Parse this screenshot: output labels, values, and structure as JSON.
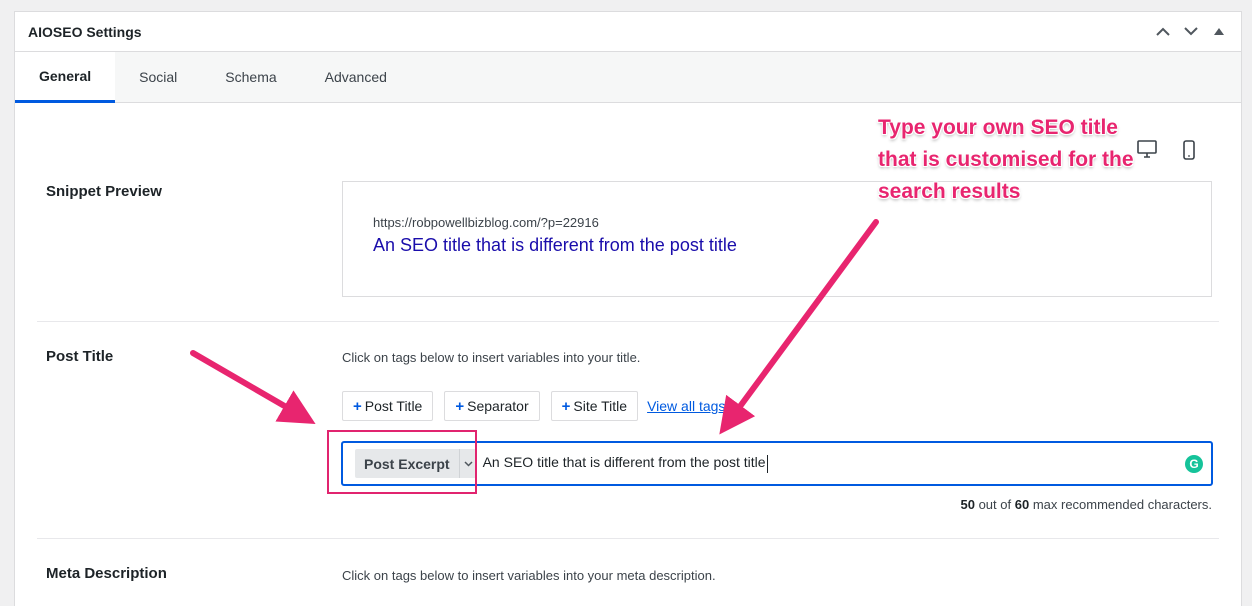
{
  "panel": {
    "title": "AIOSEO Settings"
  },
  "tabs": [
    "General",
    "Social",
    "Schema",
    "Advanced"
  ],
  "snippet_preview": {
    "label": "Snippet Preview",
    "url": "https://robpowellbizblog.com/?p=22916",
    "title": "An SEO title that is different from the post title"
  },
  "post_title": {
    "label": "Post Title",
    "hint": "Click on tags below to insert variables into your title.",
    "tags": [
      "Post Title",
      "Separator",
      "Site Title"
    ],
    "view_all": "View all tags →",
    "chip": "Post Excerpt",
    "value": "An SEO title that is different from the post title",
    "count": "50",
    "count_mid": "out of",
    "max": "60",
    "count_suffix": "max recommended characters."
  },
  "meta_description": {
    "label": "Meta Description",
    "hint": "Click on tags below to insert variables into your meta description."
  },
  "annotation": {
    "line1": "Type your own SEO title",
    "line2": "that is customised for the",
    "line3": "search results",
    "color": "#e8256f"
  },
  "colors": {
    "accent": "#005ae0",
    "snippet_title": "#1a0dab",
    "grammarly": "#15c39a"
  },
  "icons": [
    "chevron-up-icon",
    "chevron-down-icon",
    "collapse-triangle-icon",
    "desktop-icon",
    "mobile-icon",
    "grammarly-icon"
  ]
}
